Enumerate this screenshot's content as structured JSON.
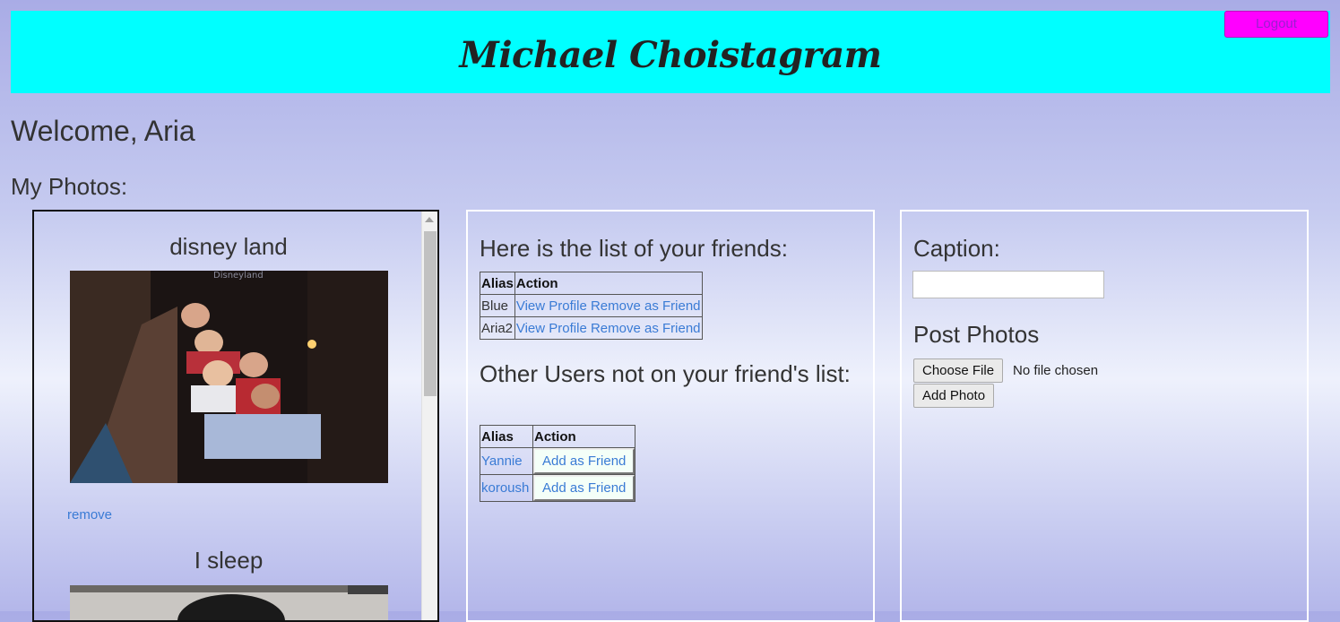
{
  "header": {
    "site_title": "Michael Choistagram",
    "logout_label": "Logout"
  },
  "welcome_text": "Welcome, Aria",
  "my_photos_label": "My Photos:",
  "photos": [
    {
      "caption": "disney land",
      "image_icon": "photo-image",
      "remove_label": "remove"
    },
    {
      "caption": "I sleep",
      "image_icon": "photo-image"
    }
  ],
  "friends": {
    "heading": "Here is the list of your friends:",
    "columns": [
      "Alias",
      "Action"
    ],
    "rows": [
      {
        "alias": "Blue",
        "view_label": "View Profile",
        "remove_label": "Remove as Friend"
      },
      {
        "alias": "Aria2",
        "view_label": "View Profile",
        "remove_label": "Remove as Friend"
      }
    ]
  },
  "others": {
    "heading": "Other Users not on your friend's list:",
    "columns": [
      "Alias",
      "Action"
    ],
    "rows": [
      {
        "alias": "Yannie",
        "add_label": "Add as Friend"
      },
      {
        "alias": "koroush",
        "add_label": "Add as Friend"
      }
    ]
  },
  "post": {
    "caption_label": "Caption:",
    "caption_value": "",
    "post_heading": "Post Photos",
    "choose_file_label": "Choose File",
    "no_file_text": "No file chosen",
    "add_photo_label": "Add Photo"
  },
  "colors": {
    "header_bg": "#00ffff",
    "logout_bg": "#ff00ff",
    "link": "#3a7bd5"
  }
}
